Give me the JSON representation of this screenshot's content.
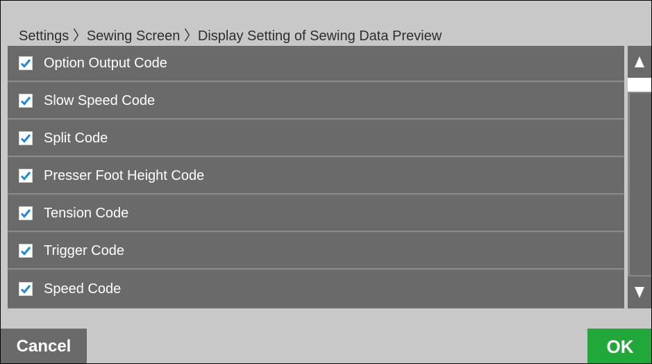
{
  "breadcrumb": {
    "text": "Settings 〉Sewing Screen 〉Display Setting of Sewing Data Preview"
  },
  "list": {
    "items": [
      {
        "label": "Option Output Code",
        "checked": true
      },
      {
        "label": "Slow Speed Code",
        "checked": true
      },
      {
        "label": "Split Code",
        "checked": true
      },
      {
        "label": "Presser Foot Height Code",
        "checked": true
      },
      {
        "label": "Tension Code",
        "checked": true
      },
      {
        "label": "Trigger Code",
        "checked": true
      },
      {
        "label": "Speed Code",
        "checked": true
      }
    ]
  },
  "footer": {
    "cancel_label": "Cancel",
    "ok_label": "OK"
  },
  "colors": {
    "ok_green": "#22a83a",
    "check_blue": "#1e88d8",
    "row_gray": "#6a6a6a"
  }
}
